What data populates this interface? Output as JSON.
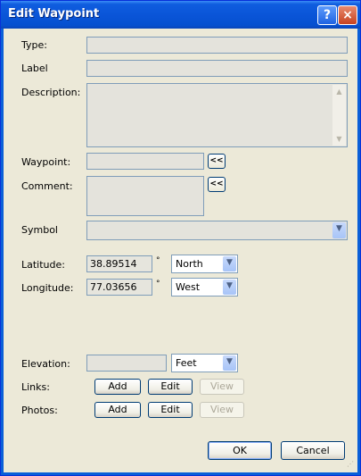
{
  "window": {
    "title": "Edit Waypoint",
    "help_icon": "?",
    "close_icon": "×"
  },
  "labels": {
    "type": "Type:",
    "label": "Label",
    "description": "Description:",
    "waypoint": "Waypoint:",
    "comment": "Comment:",
    "symbol": "Symbol",
    "latitude": "Latitude:",
    "longitude": "Longitude:",
    "elevation": "Elevation:",
    "links": "Links:",
    "photos": "Photos:"
  },
  "values": {
    "type": "",
    "label": "",
    "description": "",
    "waypoint": "",
    "comment": "",
    "symbol": "",
    "latitude": "38.89514",
    "longitude": "77.03656",
    "latitude_dir": "North",
    "longitude_dir": "West",
    "elevation": "",
    "elevation_unit": "Feet",
    "degree_symbol": "°"
  },
  "buttons": {
    "copy_waypoint": "<<",
    "copy_comment": "<<",
    "links_add": "Add",
    "links_edit": "Edit",
    "links_view": "View",
    "photos_add": "Add",
    "photos_edit": "Edit",
    "photos_view": "View",
    "ok": "OK",
    "cancel": "Cancel"
  },
  "icons": {
    "dropdown": "▼",
    "scroll_up": "▲",
    "scroll_down": "▼",
    "resize_grip": "⋰"
  }
}
